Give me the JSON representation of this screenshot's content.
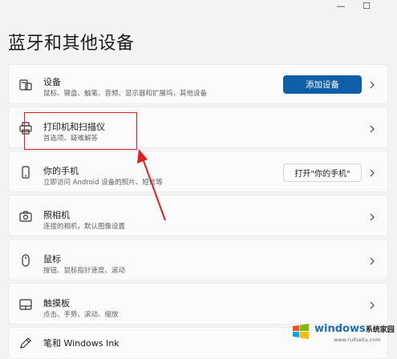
{
  "window": {
    "minimize_glyph": "—",
    "maximize_glyph": "☐"
  },
  "page": {
    "title": "蓝牙和其他设备"
  },
  "cards": [
    {
      "id": "devices",
      "title": "设备",
      "desc": "鼠标、键盘、触笔、音频、显示器和扩展坞，其他设备",
      "button": "添加设备",
      "icon": "devices-icon"
    },
    {
      "id": "printers",
      "title": "打印机和扫描仪",
      "desc": "首选项、疑难解答",
      "icon": "printer-icon"
    },
    {
      "id": "phone",
      "title": "你的手机",
      "desc": "立即访问 Android 设备的照片、短信等",
      "button": "打开\"你的手机\"",
      "icon": "phone-icon"
    },
    {
      "id": "camera",
      "title": "照相机",
      "desc": "连接的相机，默认图像设置",
      "icon": "camera-icon"
    },
    {
      "id": "mouse",
      "title": "鼠标",
      "desc": "按钮、鼠标指针速度、滚动",
      "icon": "mouse-icon"
    },
    {
      "id": "touchpad",
      "title": "触摸板",
      "desc": "点击、手势、滚动、缩放",
      "icon": "touchpad-icon"
    },
    {
      "id": "pen",
      "title": "笔和 Windows Ink",
      "desc": "",
      "icon": "pen-icon"
    }
  ],
  "watermark": {
    "brand": "windows",
    "brand_zh": "系统家园",
    "url": "www.ruihaitu.com"
  },
  "colors": {
    "accent": "#0f5ea8",
    "annotation": "#e02020",
    "background": "#f3f3f3",
    "card": "#fbfbfb"
  }
}
